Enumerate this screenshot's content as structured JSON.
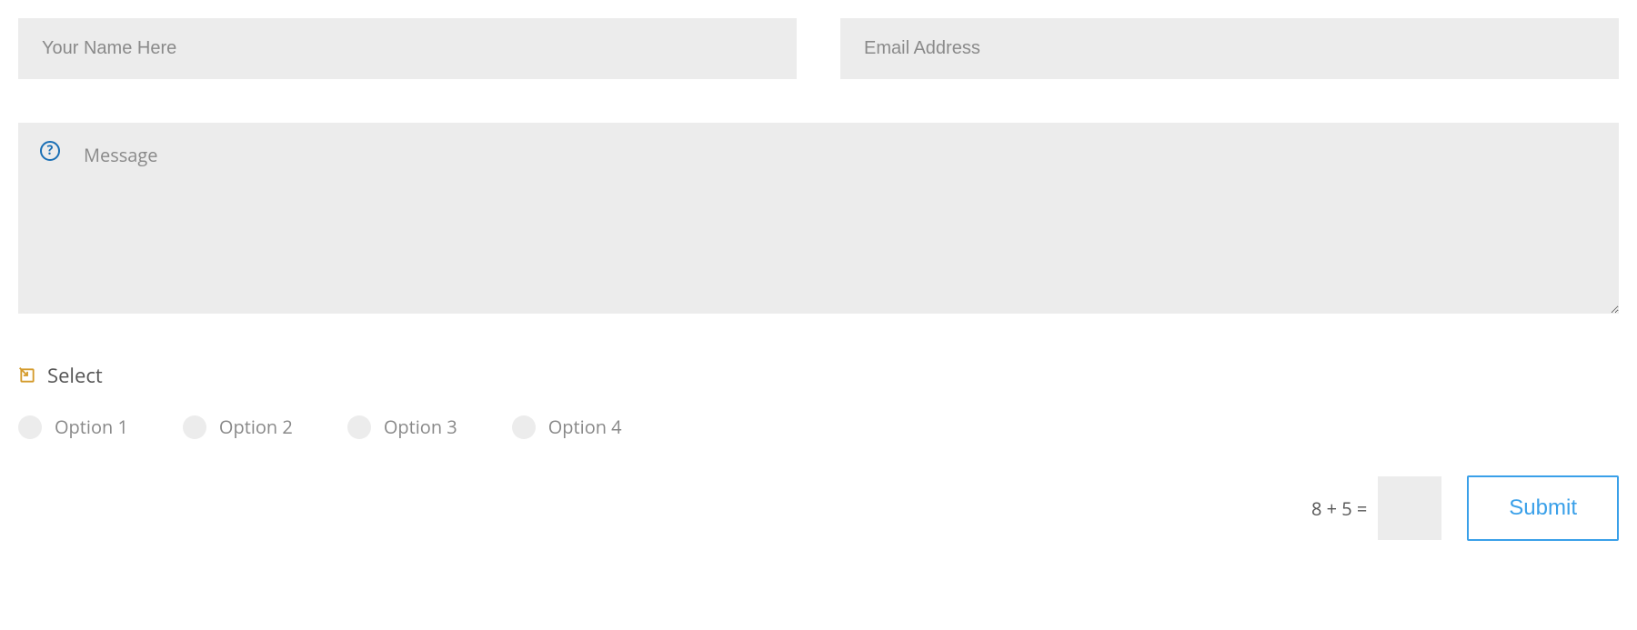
{
  "fields": {
    "name_placeholder": "Your Name Here",
    "email_placeholder": "Email Address",
    "message_placeholder": "Message"
  },
  "select": {
    "label": "Select",
    "options": [
      "Option 1",
      "Option 2",
      "Option 3",
      "Option 4"
    ]
  },
  "captcha": {
    "question": "8 + 5 ="
  },
  "submit_label": "Submit",
  "help_glyph": "?"
}
